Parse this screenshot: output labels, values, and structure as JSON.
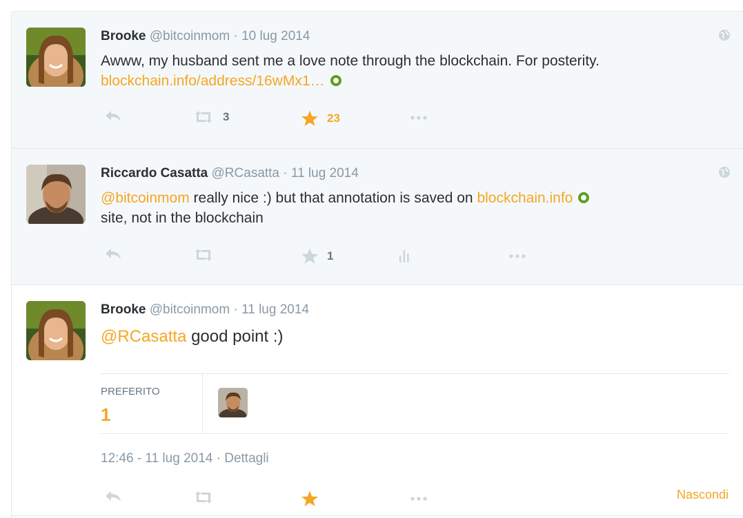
{
  "tweets": [
    {
      "name": "Brooke",
      "handle": "@bitcoinmom",
      "date": "· 10 lug 2014",
      "text": "Awww, my husband sent me a love note through the blockchain. For posterity.",
      "link": "blockchain.info/address/16wMx1…",
      "retweets": "3",
      "favorites": "23"
    },
    {
      "name": "Riccardo Casatta",
      "handle": "@RCasatta",
      "date": "· 11 lug 2014",
      "mention": "@bitcoinmom",
      "text_mid": " really nice :) but that annotation is saved on ",
      "link": "blockchain.info",
      "text_end": "site, not in the blockchain",
      "favorites": "1"
    },
    {
      "name": "Brooke",
      "handle": "@bitcoinmom",
      "date": "· 11 lug 2014",
      "mention": "@RCasatta",
      "text": " good point :)",
      "stats_label": "PREFERITO",
      "stats_value": "1",
      "timestamp": "12:46 - 11 lug 2014",
      "details_link": "· Dettagli",
      "hide_label": "Nascondi"
    }
  ],
  "colors": {
    "accent": "#f5a623",
    "muted": "#8899a6",
    "background_expanded": "#f5f8fa",
    "border": "#e1e8ed"
  },
  "icons": [
    "reply-icon",
    "retweet-icon",
    "star-icon",
    "more-icon",
    "analytics-icon",
    "globe-icon",
    "link-preview-icon"
  ]
}
